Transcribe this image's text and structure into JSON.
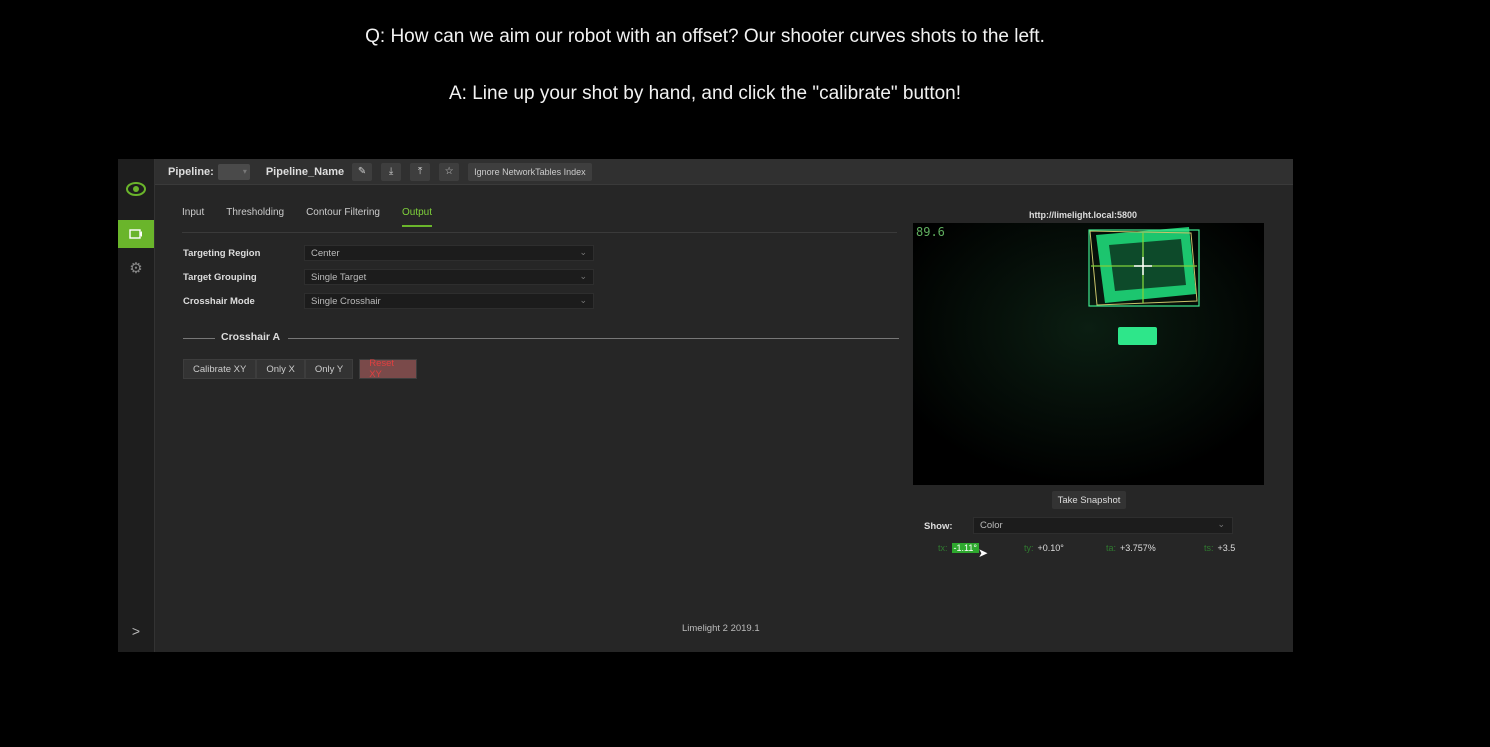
{
  "caption": {
    "question": "Q: How can we aim our robot with an offset? Our shooter curves shots to the left.",
    "answer": "A: Line up your shot by hand, and click the \"calibrate\" button!"
  },
  "sidebar": {
    "items": [
      {
        "icon": "limelight-logo-icon"
      },
      {
        "icon": "camera-icon",
        "active": true
      },
      {
        "icon": "gear-icon"
      }
    ],
    "expand_icon": "chevron-right-icon"
  },
  "toolbar": {
    "pipeline_label": "Pipeline:",
    "pipeline_name": "Pipeline_Name",
    "icons": [
      "pencil-icon",
      "download-icon",
      "upload-icon",
      "star-icon"
    ],
    "ignore_label": "Ignore NetworkTables Index"
  },
  "tabs": [
    {
      "label": "Input",
      "active": false
    },
    {
      "label": "Thresholding",
      "active": false
    },
    {
      "label": "Contour Filtering",
      "active": false
    },
    {
      "label": "Output",
      "active": true
    }
  ],
  "fields": [
    {
      "label": "Targeting Region",
      "value": "Center"
    },
    {
      "label": "Target Grouping",
      "value": "Single Target"
    },
    {
      "label": "Crosshair Mode",
      "value": "Single Crosshair"
    }
  ],
  "crosshair": {
    "title": "Crosshair A",
    "buttons": [
      "Calibrate XY",
      "Only X",
      "Only Y"
    ],
    "reset_label": "Reset XY"
  },
  "footer": "Limelight 2 2019.1",
  "camera": {
    "url": "http://limelight.local:5800",
    "fps": "89.6",
    "snapshot_label": "Take Snapshot",
    "show_label": "Show:",
    "show_value": "Color"
  },
  "readouts": [
    {
      "key": "tx:",
      "value": "-1.11°",
      "highlight": true
    },
    {
      "key": "ty:",
      "value": "+0.10°"
    },
    {
      "key": "ta:",
      "value": "+3.757%"
    },
    {
      "key": "ts:",
      "value": "+3.5"
    }
  ],
  "colors": {
    "accent": "#6ab52b",
    "target": "#2ee68a"
  }
}
